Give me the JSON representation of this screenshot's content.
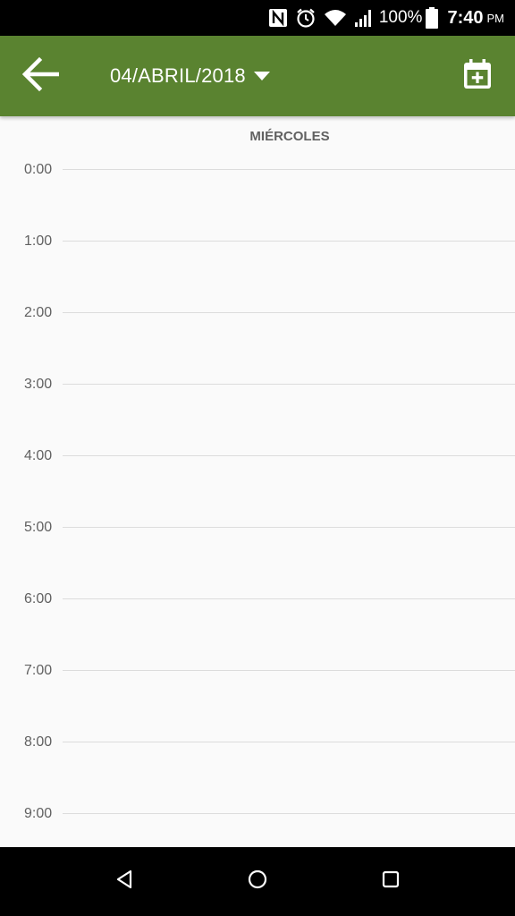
{
  "status_bar": {
    "battery_percent": "100%",
    "time": "7:40",
    "ampm": "PM",
    "icons": [
      "nfc-icon",
      "alarm-icon",
      "wifi-icon",
      "signal-icon",
      "battery-icon"
    ]
  },
  "app_bar": {
    "back_icon": "arrow-back-icon",
    "date_label": "04/ABRIL/2018",
    "date_dropdown_icon": "caret-down-icon",
    "add_event_icon": "calendar-plus-icon",
    "background_color": "#5a8330"
  },
  "day_view": {
    "day_name": "MIÉRCOLES",
    "hours": [
      {
        "label": "0:00"
      },
      {
        "label": "1:00"
      },
      {
        "label": "2:00"
      },
      {
        "label": "3:00"
      },
      {
        "label": "4:00"
      },
      {
        "label": "5:00"
      },
      {
        "label": "6:00"
      },
      {
        "label": "7:00"
      },
      {
        "label": "8:00"
      },
      {
        "label": "9:00"
      }
    ]
  },
  "nav_bar": {
    "icons": [
      "back-triangle-icon",
      "home-circle-icon",
      "recents-square-icon"
    ]
  }
}
